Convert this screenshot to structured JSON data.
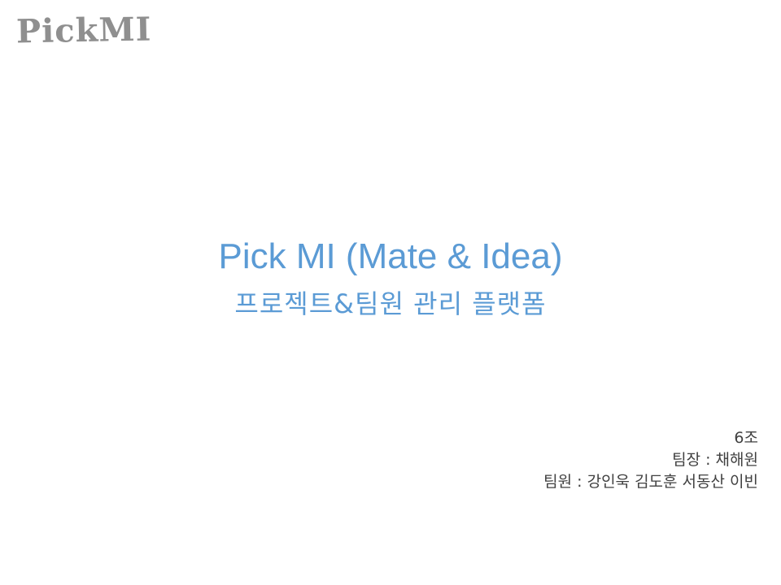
{
  "logo": {
    "text": "PickMI"
  },
  "title": {
    "main": "Pick MI (Mate & Idea)",
    "subtitle": "프로젝트&팀원 관리 플랫폼"
  },
  "team": {
    "group": "6조",
    "leader": "팀장 : 채해원",
    "members": "팀원 : 강인욱  김도훈  서동산  이빈"
  }
}
